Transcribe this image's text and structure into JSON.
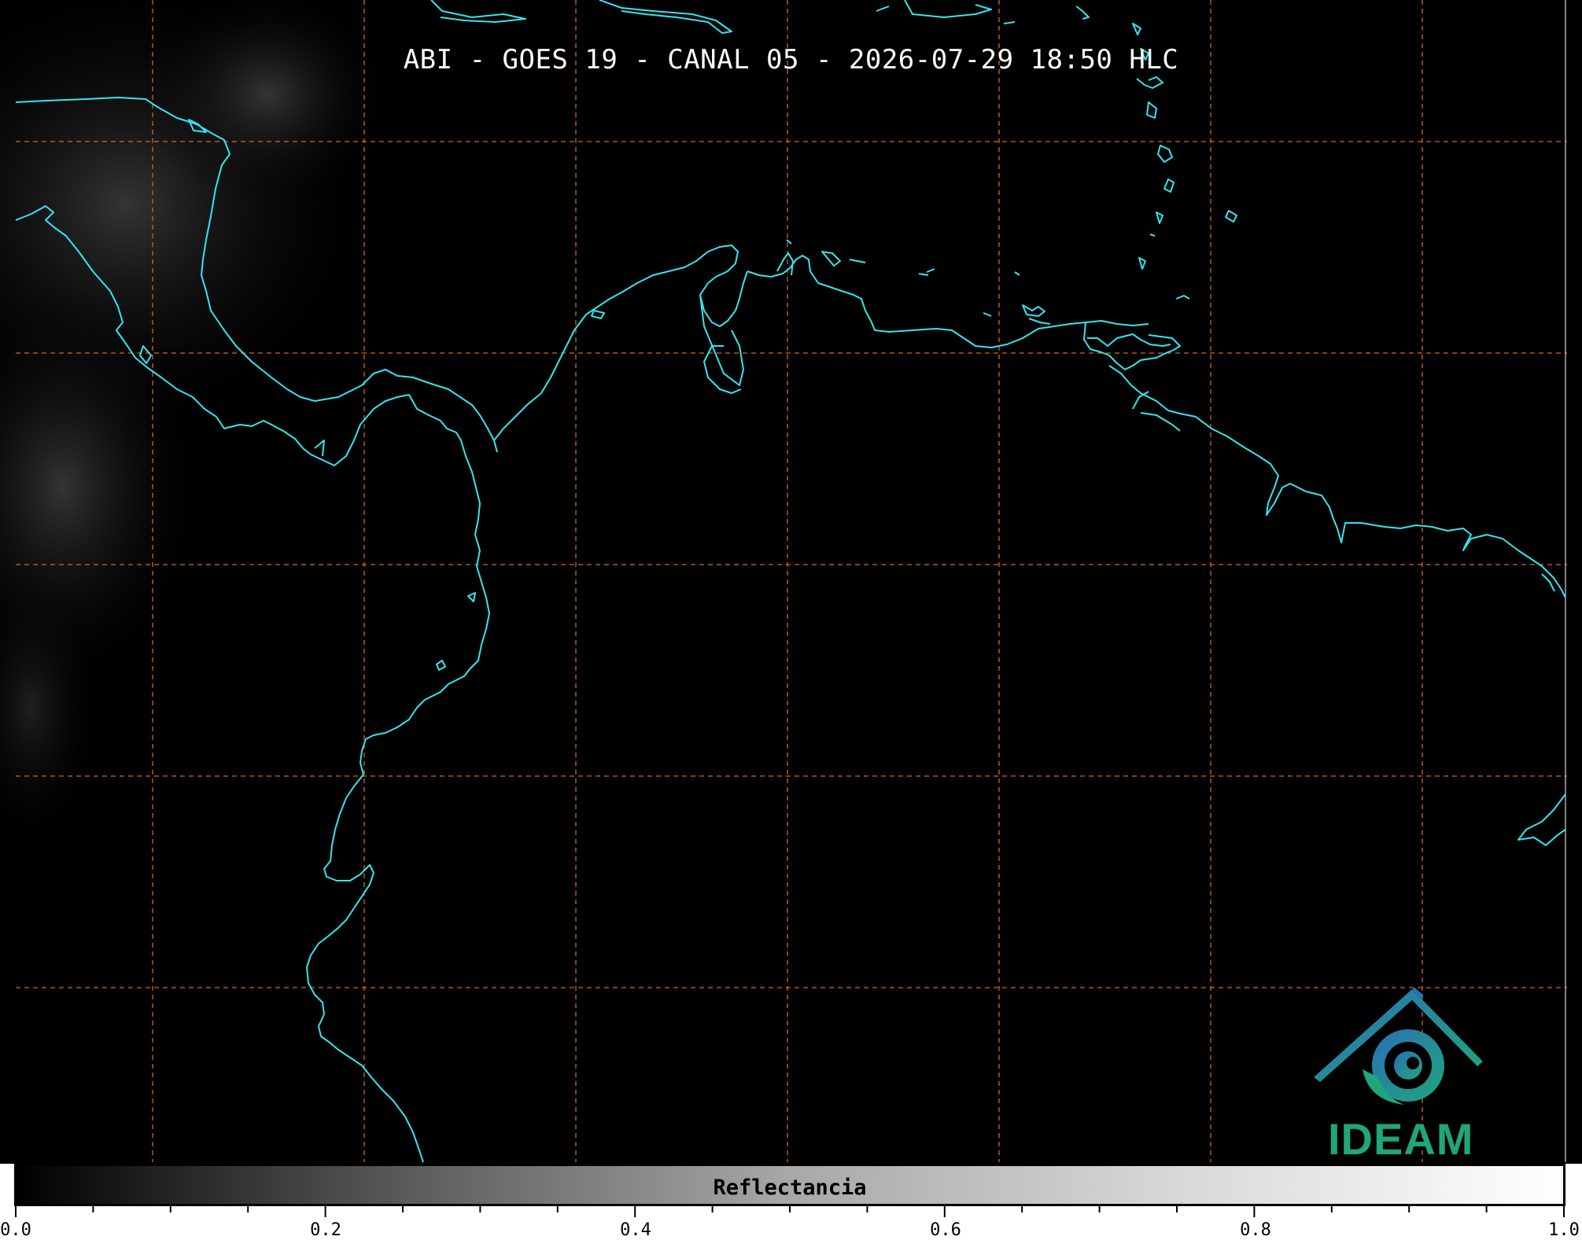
{
  "title": "ABI - GOES 19 - CANAL 05 - 2026-07-29 18:50 HLC",
  "colorbar": {
    "label": "Reflectancia",
    "ticks": [
      "0.0",
      "0.2",
      "0.4",
      "0.6",
      "0.8",
      "1.0"
    ],
    "range": [
      0.0,
      1.0
    ],
    "colors": [
      "#000000",
      "#ffffff"
    ]
  },
  "logo": {
    "text": "IDEAM",
    "colors": [
      "#2b6fb6",
      "#1fa67a"
    ]
  },
  "map": {
    "coastline_color": "#33e6f0",
    "gridline_color": "#d2691e",
    "gridline_style": "dashed",
    "background_color": "#000000"
  }
}
